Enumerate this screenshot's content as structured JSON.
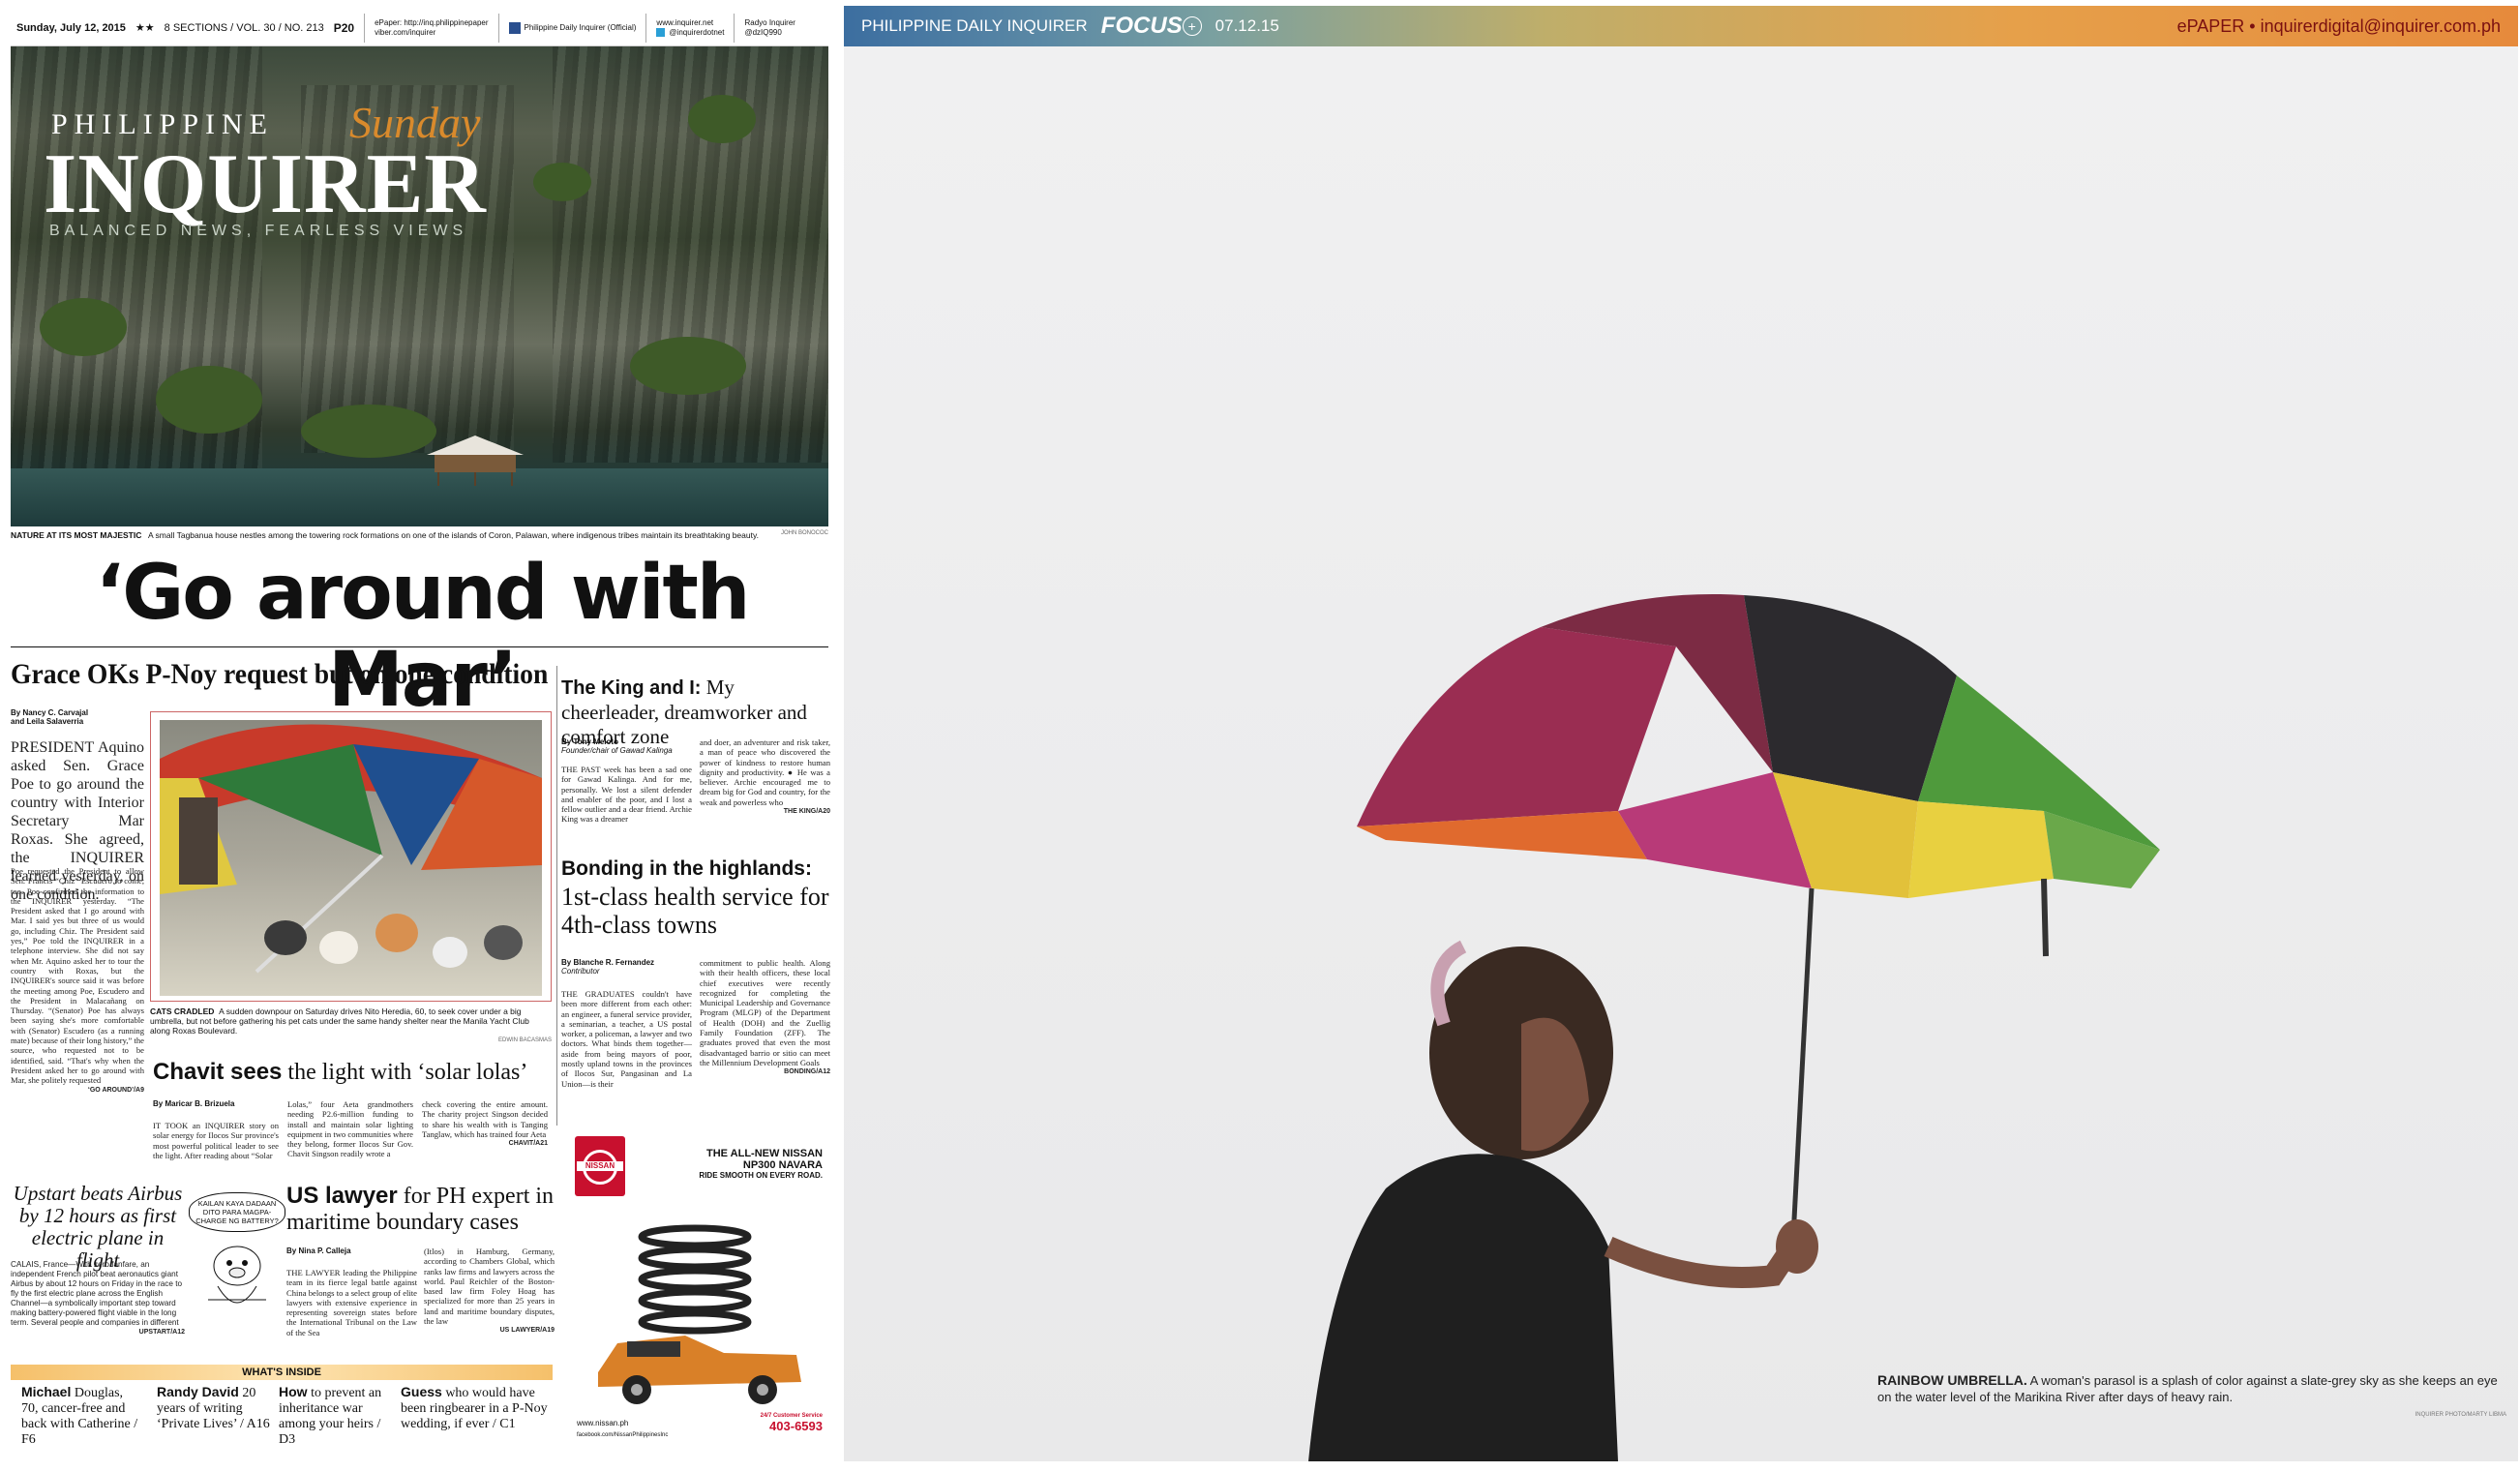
{
  "left_page": {
    "top_strip": {
      "date": "Sunday, July 12, 2015",
      "stars": "★★",
      "issue": "8 SECTIONS / VOL. 30 / NO. 213",
      "page": "P20",
      "epaper": "ePaper: http://inq.philippinepaper",
      "viber": "viber.com/inquirer",
      "facebook": "Philippine Daily Inquirer (Official)",
      "web": "www.inquirer.net",
      "twitter": "@inquirerdotnet",
      "radyo": "Radyo Inquirer",
      "radyo_handle": "@dzIQ990"
    },
    "masthead": {
      "philippine": "PHILIPPINE",
      "sunday": "Sunday",
      "inquirer": "INQUIRER",
      "tagline": "BALANCED NEWS, FEARLESS VIEWS"
    },
    "hero_caption": {
      "kicker": "NATURE AT ITS MOST MAJESTIC",
      "text": "A small Tagbanua house nestles among the towering rock formations on one of the islands of Coron, Palawan, where indigenous tribes maintain its breathtaking beauty.",
      "credit": "JOHN BONOCOC"
    },
    "headline": "‘Go around with Mar’",
    "subhead": "Grace OKs P-Noy request but on one condition",
    "main_story": {
      "byline1": "By Nancy C. Carvajal",
      "byline2": "and Leila Salaverria",
      "lede": "PRESIDENT Aquino asked Sen. Grace Poe to go around the country with Interior Secretary Mar Roxas. She agreed, the INQUIRER learned yesterday, on one condition.",
      "body": "Poe requested the President to allow Sen. Francis “Chiz” Escudero to come, too. Poe confirmed the information to the INQUIRER yesterday. “The President asked that I go around with Mar. I said yes but three of us would go, including Chiz. The President said yes,” Poe told the INQUIRER in a telephone interview. She did not say when Mr. Aquino asked her to tour the country with Roxas, but the INQUIRER's source said it was before the meeting among Poe, Escudero and the President in Malacañang on Thursday. “(Senator) Poe has always been saying she's more comfortable with (Senator) Escudero (as a running mate) because of their long history,” the source, who requested not to be identified, said. “That's why when the President asked her to go around with Mar, she politely requested",
      "jump": "‘GO AROUND’/A9"
    },
    "cat_caption": {
      "kicker": "CATS CRADLED",
      "text": "A sudden downpour on Saturday drives Nito Heredia, 60, to seek cover under a big umbrella, but not before gathering his pet cats under the same handy shelter near the Manila Yacht Club along Roxas Boulevard.",
      "credit": "EDWIN BACASMAS"
    },
    "king_story": {
      "head_bold": "The King and I:",
      "head_rest": "My cheerleader, dreamworker and comfort zone",
      "byline": "By Tony Meloto",
      "role": "Founder/chair of Gawad Kalinga",
      "col1": "THE PAST week has been a sad one for Gawad Kalinga. And for me, personally. We lost a silent defender and enabler of the poor, and I lost a fellow outlier and a dear friend. Archie King was a dreamer",
      "col2": "and doer, an adventurer and risk taker, a man of peace who discovered the power of kindness to restore human dignity and productivity. ● He was a believer. Archie encouraged me to dream big for God and country, for the weak and powerless who",
      "jump": "THE KING/A20"
    },
    "health_story": {
      "head1": "Bonding in the highlands:",
      "head2": "1st-class health service for 4th-class towns",
      "byline": "By Blanche R. Fernandez",
      "role": "Contributor",
      "col1": "THE GRADUATES couldn't have been more different from each other: an engineer, a funeral service provider, a seminarian, a teacher, a US postal worker, a policeman, a lawyer and two doctors. What binds them together—aside from being mayors of poor, mostly upland towns in the provinces of Ilocos Sur, Pangasinan and La Union—is their",
      "col2": "commitment to public health. Along with their health officers, these local chief executives were recently recognized for completing the Municipal Leadership and Governance Program (MLGP) of the Department of Health (DOH) and the Zuellig Family Foundation (ZFF). The graduates proved that even the most disadvantaged barrio or sitio can meet the Millennium Development Goals",
      "jump": "BONDING/A12"
    },
    "chavit_story": {
      "head_bold": "Chavit sees",
      "head_rest": "the light with ‘solar lolas’",
      "byline": "By Maricar B. Brizuela",
      "col1": "IT TOOK an INQUIRER story on solar energy for Ilocos Sur province's most powerful political leader to see the light. After reading about “Solar",
      "col2": "Lolas,” four Aeta grandmothers needing P2.6-million funding to install and maintain solar lighting equipment in two communities where they belong, former Ilocos Sur Gov. Chavit Singson readily wrote a",
      "col3": "check covering the entire amount. The charity project Singson decided to share his wealth with is Tanging Tanglaw, which has trained four Aeta",
      "jump": "CHAVIT/A21"
    },
    "upstart_story": {
      "head": "Upstart beats Airbus by 12 hours as first electric plane in flight",
      "body": "CALAIS, France—With zero fanfare, an independent French pilot beat aeronautics giant Airbus by about 12 hours on Friday in the race to fly the first electric plane across the English Channel—a symbolically important step toward making battery-powered flight viable in the long term. Several people and companies in different",
      "jump": "UPSTART/A12",
      "cartoon": "KAILAN KAYA DADAAN DITO PARA MAGPA-CHARGE NG BATTERY?"
    },
    "us_lawyer_story": {
      "head_bold": "US lawyer",
      "head_rest": "for PH expert in maritime boundary cases",
      "byline": "By Nina P. Calleja",
      "col1": "THE LAWYER leading the Philippine team in its fierce legal battle against China belongs to a select group of elite lawyers with extensive experience in representing sovereign states before the International Tribunal on the Law of the Sea",
      "col2": "(Itlos) in Hamburg, Germany, according to Chambers Global, which ranks law firms and lawyers across the world. Paul Reichler of the Boston-based law firm Foley Hoag has specialized for more than 25 years in land and maritime boundary disputes, the law",
      "jump": "US LAWYER/A19"
    },
    "ad": {
      "brand": "NISSAN",
      "line1": "THE ALL-NEW NISSAN",
      "line2": "NP300 NAVARA",
      "line3": "RIDE SMOOTH ON EVERY ROAD.",
      "site": "www.nissan.ph",
      "fb": "facebook.com/NissanPhilippinesInc",
      "hotline_label": "24/7 Customer Service",
      "hotline": "403-6593"
    },
    "whats_inside": {
      "label": "WHAT'S INSIDE",
      "items": [
        {
          "bold": "Michael",
          "rest": "Douglas, 70, cancer-free and back with Catherine / F6"
        },
        {
          "bold": "Randy David",
          "rest": "20 years of writing ‘Private Lives’ / A16"
        },
        {
          "bold": "How",
          "rest": "to prevent an inheritance war among your heirs / D3"
        },
        {
          "bold": "Guess",
          "rest": "who would have been ringbearer in a P-Noy wedding, if ever / C1"
        }
      ]
    }
  },
  "right_page": {
    "header": {
      "paper": "PHILIPPINE DAILY INQUIRER",
      "section": "FOCUS",
      "date": "07.12.15",
      "epaper": "ePAPER • inquirerdigital@inquirer.com.ph"
    },
    "caption": {
      "kicker": "RAINBOW UMBRELLA.",
      "text": "A woman's parasol is a splash of color against a slate-grey sky as she keeps an eye on the water level of the Marikina River after days of heavy rain.",
      "credit": "INQUIRER PHOTO/MARTY LIBMA"
    }
  },
  "colors": {
    "accent_orange": "#e68a3c",
    "ad_red": "#c8102e",
    "inside_band": "#f5c06a"
  }
}
